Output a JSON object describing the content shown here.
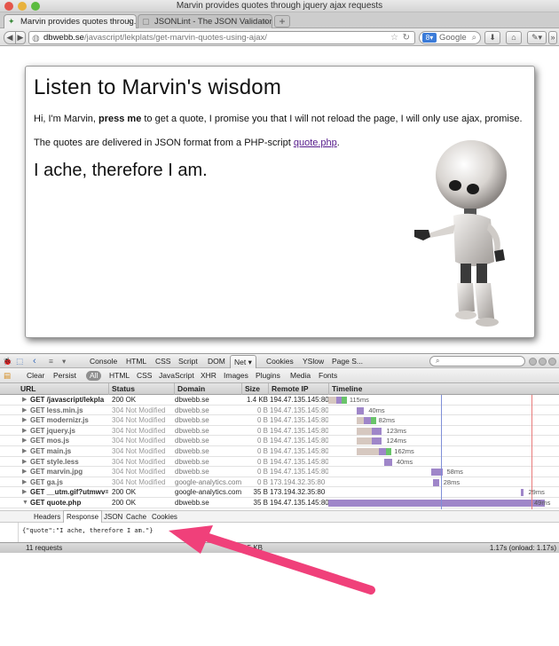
{
  "window": {
    "title": "Marvin provides quotes through jquery ajax requests"
  },
  "tabs": [
    {
      "label": "Marvin provides quotes throug...",
      "active": true
    },
    {
      "label": "JSONLint - The JSON Validator.",
      "active": false
    }
  ],
  "navbar": {
    "url_host": "dbwebb.se",
    "url_path": "/javascript/lekplats/get-marvin-quotes-using-ajax/",
    "search_placeholder": "Google"
  },
  "page": {
    "heading": "Listen to Marvin's wisdom",
    "intro_before": "Hi, I'm Marvin, ",
    "intro_bold": "press me",
    "intro_after": " to get a quote, I promise you that I will not reload the page, I will only use ajax, promise.",
    "json_before": "The quotes are delivered in JSON format from a PHP-script ",
    "json_link": "quote.php",
    "json_after": ".",
    "quote": "I ache, therefore I am."
  },
  "firebug": {
    "panels": [
      "Console",
      "HTML",
      "CSS",
      "Script",
      "DOM",
      "Net",
      "Cookies",
      "YSlow",
      "Page S..."
    ],
    "active_panel": "Net",
    "filters": [
      "Clear",
      "Persist",
      "All",
      "HTML",
      "CSS",
      "JavaScript",
      "XHR",
      "Images",
      "Plugins",
      "Media",
      "Fonts"
    ],
    "active_filter": "All",
    "columns": [
      "URL",
      "Status",
      "Domain",
      "Size",
      "Remote IP",
      "Timeline"
    ],
    "requests": [
      {
        "url": "GET /javascript/lekpla",
        "status": "200 OK",
        "domain": "dbwebb.se",
        "size": "1.4 KB",
        "ip": "194.47.135.145:80",
        "time": "115ms",
        "cached": false,
        "start": 0.0,
        "wait": 0.035,
        "recv": 0.04,
        "green": true
      },
      {
        "url": "GET less.min.js",
        "status": "304 Not Modified",
        "domain": "dbwebb.se",
        "size": "0 B",
        "ip": "194.47.135.145:80",
        "time": "40ms",
        "cached": true,
        "start": 0.125,
        "wait": 0.0,
        "recv": 0.035,
        "green": false
      },
      {
        "url": "GET modernizr.js",
        "status": "304 Not Modified",
        "domain": "dbwebb.se",
        "size": "0 B",
        "ip": "194.47.135.145:80",
        "time": "82ms",
        "cached": true,
        "start": 0.125,
        "wait": 0.035,
        "recv": 0.045,
        "green": true
      },
      {
        "url": "GET jquery.js",
        "status": "304 Not Modified",
        "domain": "dbwebb.se",
        "size": "0 B",
        "ip": "194.47.135.145:80",
        "time": "123ms",
        "cached": true,
        "start": 0.125,
        "wait": 0.07,
        "recv": 0.045,
        "green": false
      },
      {
        "url": "GET mos.js",
        "status": "304 Not Modified",
        "domain": "dbwebb.se",
        "size": "0 B",
        "ip": "194.47.135.145:80",
        "time": "124ms",
        "cached": true,
        "start": 0.125,
        "wait": 0.07,
        "recv": 0.045,
        "green": false
      },
      {
        "url": "GET main.js",
        "status": "304 Not Modified",
        "domain": "dbwebb.se",
        "size": "0 B",
        "ip": "194.47.135.145:80",
        "time": "162ms",
        "cached": true,
        "start": 0.125,
        "wait": 0.1,
        "recv": 0.05,
        "green": true
      },
      {
        "url": "GET style.less",
        "status": "304 Not Modified",
        "domain": "dbwebb.se",
        "size": "0 B",
        "ip": "194.47.135.145:80",
        "time": "40ms",
        "cached": true,
        "start": 0.25,
        "wait": 0.0,
        "recv": 0.035,
        "green": false
      },
      {
        "url": "GET marvin.jpg",
        "status": "304 Not Modified",
        "domain": "dbwebb.se",
        "size": "0 B",
        "ip": "194.47.135.145:80",
        "time": "58ms",
        "cached": true,
        "start": 0.46,
        "wait": 0.0,
        "recv": 0.05,
        "green": false
      },
      {
        "url": "GET ga.js",
        "status": "304 Not Modified",
        "domain": "google-analytics.com",
        "size": "0 B",
        "ip": "173.194.32.35:80",
        "time": "28ms",
        "cached": true,
        "start": 0.47,
        "wait": 0.0,
        "recv": 0.025,
        "green": false
      },
      {
        "url": "GET __utm.gif?utmwv=",
        "status": "200 OK",
        "domain": "google-analytics.com",
        "size": "35 B",
        "ip": "173.194.32.35:80",
        "time": "29ms",
        "cached": false,
        "start": 0.86,
        "wait": 0.0,
        "recv": 0.015,
        "green": false
      },
      {
        "url": "GET quote.php",
        "status": "200 OK",
        "domain": "dbwebb.se",
        "size": "35 B",
        "ip": "194.47.135.145:80",
        "time": "49ms",
        "cached": false,
        "start": 0.0,
        "wait": 0.0,
        "recv": 0.97,
        "green": false,
        "expanded": true
      }
    ],
    "response_tabs": [
      "Headers",
      "Response",
      "JSON",
      "Cache",
      "Cookies"
    ],
    "active_response_tab": "Response",
    "response_body": "{\"quote\":\"I ache, therefore I am.\"}",
    "status_requests": "11 requests",
    "status_size": "1.5 KB",
    "status_time": "1.17s (onload: 1.17s)"
  },
  "colors": {
    "arrow": "#f0407a",
    "timeline_blue": "#7f8fd8",
    "timeline_red": "#e87b7b",
    "link_visited": "#551a8b"
  }
}
